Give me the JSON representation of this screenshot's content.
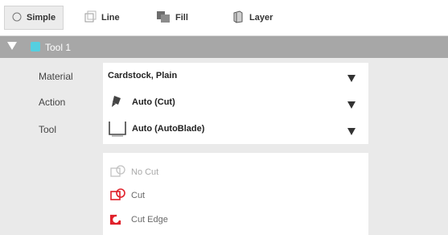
{
  "tabs": [
    {
      "label": "Simple",
      "icon": "radio-circle-icon",
      "active": true
    },
    {
      "label": "Line",
      "icon": "line-icon"
    },
    {
      "label": "Fill",
      "icon": "fill-icon"
    },
    {
      "label": "Layer",
      "icon": "layer-icon"
    }
  ],
  "tool": {
    "title": "Tool 1",
    "color": "#55cfe0"
  },
  "properties": {
    "material_label": "Material",
    "material_value": "Cardstock, Plain",
    "action_label": "Action",
    "action_value": "Auto (Cut)",
    "tool_label": "Tool",
    "tool_value": "Auto (AutoBlade)"
  },
  "cut_options": [
    {
      "label": "No Cut",
      "icon": "no-cut-icon",
      "state": "disabled"
    },
    {
      "label": "Cut",
      "icon": "cut-icon",
      "state": "normal"
    },
    {
      "label": "Cut Edge",
      "icon": "cut-edge-icon",
      "state": "normal"
    }
  ],
  "colors": {
    "accent_red": "#e0202a",
    "header_gray": "#a7a7a7"
  }
}
